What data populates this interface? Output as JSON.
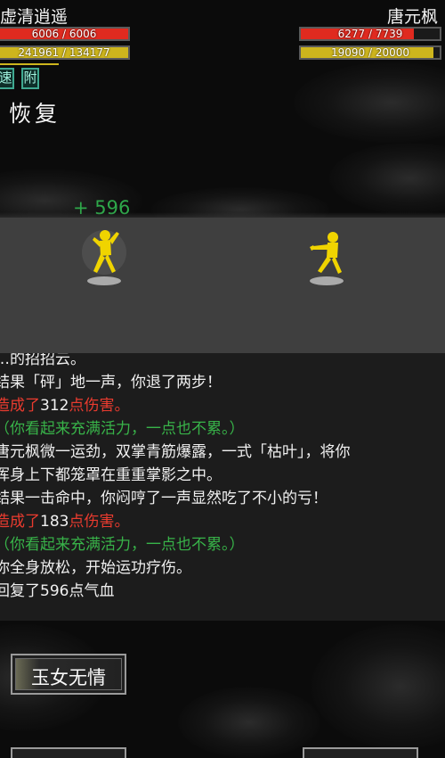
{
  "player": {
    "name": "虚清逍遥",
    "hp_text": "6006 / 6006",
    "hp_fraction": 1.0,
    "mp_text": "241961 / 134177",
    "mp_fraction": 1.0,
    "hp_color": "#e02a1f",
    "mp_color": "#cdb51d",
    "badges": [
      "速",
      "附"
    ],
    "status_title": "恢复"
  },
  "enemy": {
    "name": "唐元枫",
    "hp_text": "6277 / 7739",
    "hp_fraction": 0.811,
    "mp_text": "19090 / 20000",
    "mp_fraction": 0.955,
    "hp_color": "#e02a1f",
    "mp_color": "#cdb51d"
  },
  "battle": {
    "heal_popup": "+ 596",
    "heal_color": "#2ea84a",
    "fighter_color": "#f0d400"
  },
  "log": [
    {
      "parts": [
        {
          "t": "…的招招云。",
          "c": "white"
        }
      ]
    },
    {
      "parts": [
        {
          "t": "结果「砰」地一声，你退了两步！",
          "c": "white"
        }
      ]
    },
    {
      "parts": [
        {
          "t": "造成了",
          "c": "red"
        },
        {
          "t": "312",
          "c": "white"
        },
        {
          "t": "点伤害。",
          "c": "red"
        }
      ]
    },
    {
      "parts": [
        {
          "t": "（你看起来充满活力，一点也不累。）",
          "c": "green"
        }
      ]
    },
    {
      "parts": [
        {
          "t": "唐元枫微一运劲，双掌青筋爆露，一式「枯叶」，将你",
          "c": "white"
        }
      ]
    },
    {
      "parts": [
        {
          "t": "浑身上下都笼罩在重重掌影之中。",
          "c": "white"
        }
      ]
    },
    {
      "parts": [
        {
          "t": "结果一击命中，你闷哼了一声显然吃了不小的亏！",
          "c": "white"
        }
      ]
    },
    {
      "parts": [
        {
          "t": "造成了",
          "c": "red"
        },
        {
          "t": "183",
          "c": "white"
        },
        {
          "t": "点伤害。",
          "c": "red"
        }
      ]
    },
    {
      "parts": [
        {
          "t": "（你看起来充满活力，一点也不累。）",
          "c": "green"
        }
      ]
    },
    {
      "parts": [
        {
          "t": "你全身放松，开始运功疗伤。",
          "c": "white"
        }
      ]
    },
    {
      "parts": [
        {
          "t": "回复了596点气血",
          "c": "white"
        }
      ]
    }
  ],
  "skill": {
    "label": "玉女无情"
  }
}
